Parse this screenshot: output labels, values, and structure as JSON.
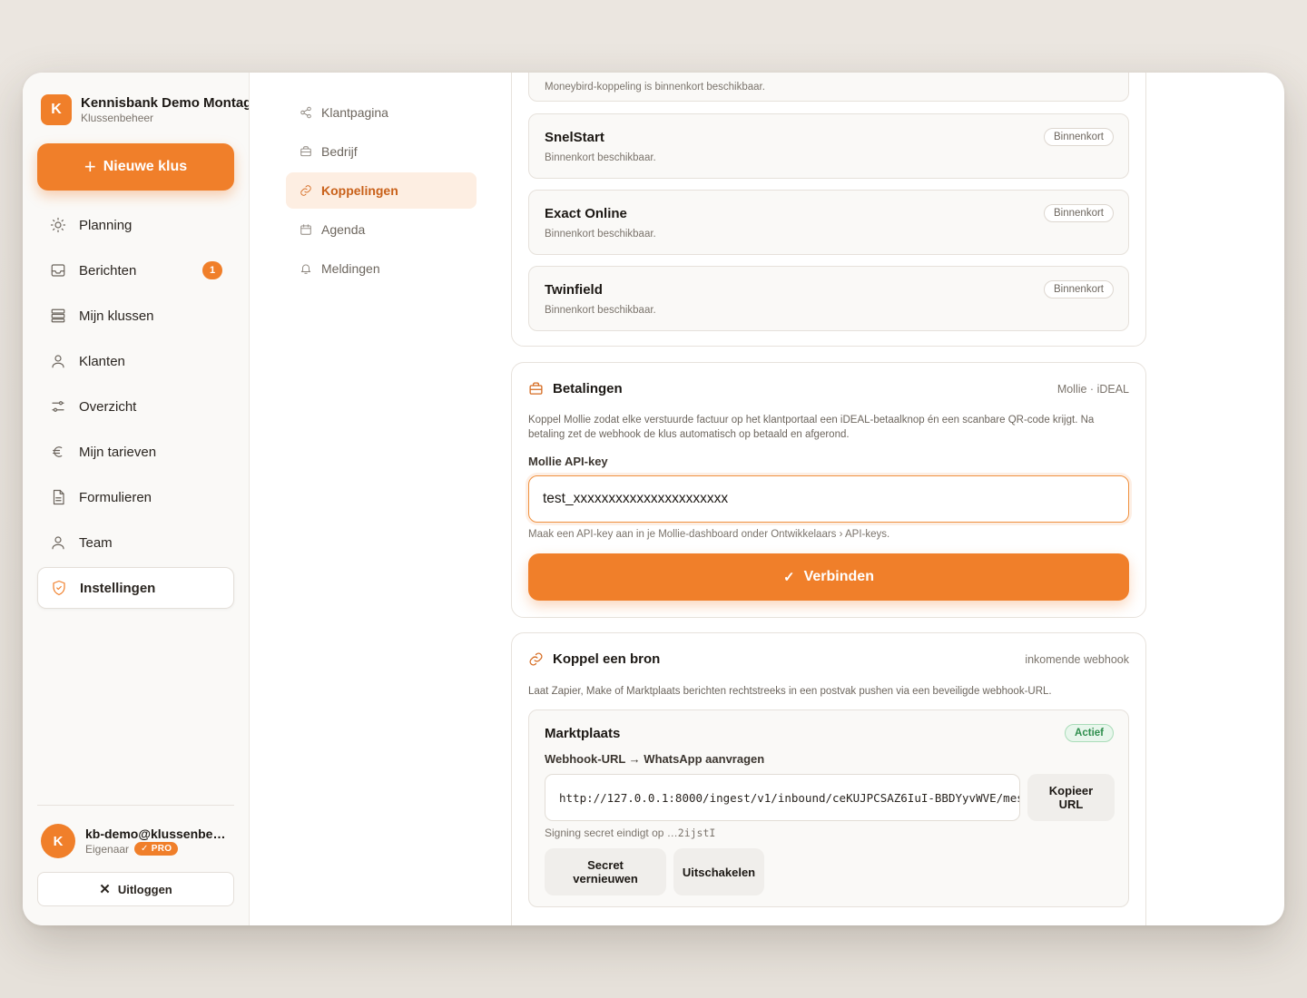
{
  "brand": {
    "initial": "K",
    "name": "Kennisbank Demo Montage",
    "subtitle": "Klussenbeheer"
  },
  "new_job_label": "Nieuwe klus",
  "nav": [
    {
      "label": "Planning",
      "icon": "sun-icon"
    },
    {
      "label": "Berichten",
      "icon": "inbox-icon",
      "badge": "1"
    },
    {
      "label": "Mijn klussen",
      "icon": "stack-icon"
    },
    {
      "label": "Klanten",
      "icon": "user-icon"
    },
    {
      "label": "Overzicht",
      "icon": "sliders-icon"
    },
    {
      "label": "Mijn tarieven",
      "icon": "euro-icon"
    },
    {
      "label": "Formulieren",
      "icon": "document-icon"
    },
    {
      "label": "Team",
      "icon": "user-icon"
    },
    {
      "label": "Instellingen",
      "icon": "shield-icon",
      "active": true
    }
  ],
  "user": {
    "initial": "K",
    "email": "kb-demo@klussenbeheer.nl",
    "role": "Eigenaar",
    "badge": "✓ PRO"
  },
  "logout_label": "Uitloggen",
  "settings_nav": [
    {
      "label": "Klantpagina",
      "icon": "share-icon"
    },
    {
      "label": "Bedrijf",
      "icon": "briefcase-icon"
    },
    {
      "label": "Koppelingen",
      "icon": "link-icon",
      "active": true
    },
    {
      "label": "Agenda",
      "icon": "calendar-icon"
    },
    {
      "label": "Meldingen",
      "icon": "bell-icon"
    }
  ],
  "accounting": {
    "moneybird_desc": "Moneybird-koppeling is binnenkort beschikbaar.",
    "items": [
      {
        "name": "SnelStart",
        "desc": "Binnenkort beschikbaar.",
        "status": "Binnenkort"
      },
      {
        "name": "Exact Online",
        "desc": "Binnenkort beschikbaar.",
        "status": "Binnenkort"
      },
      {
        "name": "Twinfield",
        "desc": "Binnenkort beschikbaar.",
        "status": "Binnenkort"
      }
    ]
  },
  "payments": {
    "title": "Betalingen",
    "meta": "Mollie · iDEAL",
    "description": "Koppel Mollie zodat elke verstuurde factuur op het klantportaal een iDEAL-betaalknop én een scanbare QR-code krijgt. Na betaling zet de webhook de klus automatisch op betaald en afgerond.",
    "field_label": "Mollie API-key",
    "api_key_value": "test_xxxxxxxxxxxxxxxxxxxxxx",
    "hint": "Maak een API-key aan in je Mollie-dashboard onder Ontwikkelaars › API-keys.",
    "connect_label": "Verbinden"
  },
  "webhook": {
    "title": "Koppel een bron",
    "meta": "inkomende webhook",
    "description": "Laat Zapier, Make of Marktplaats berichten rechtstreeks in een postvak pushen via een beveiligde webhook-URL.",
    "source": {
      "name": "Marktplaats",
      "status": "Actief",
      "url_label": "Webhook-URL → WhatsApp aanvragen",
      "url": "http://127.0.0.1:8000/ingest/v1/inbound/ceKUJPCSAZ6IuI-BBDYyvWVE/mes",
      "copy_label": "Kopieer URL",
      "secret_prefix": "Signing secret eindigt op …",
      "secret_suffix": "2ijstI",
      "renew_label": "Secret vernieuwen",
      "disable_label": "Uitschakelen"
    }
  },
  "colors": {
    "accent": "#f07f2a",
    "active_green": "#2f8f4e"
  }
}
